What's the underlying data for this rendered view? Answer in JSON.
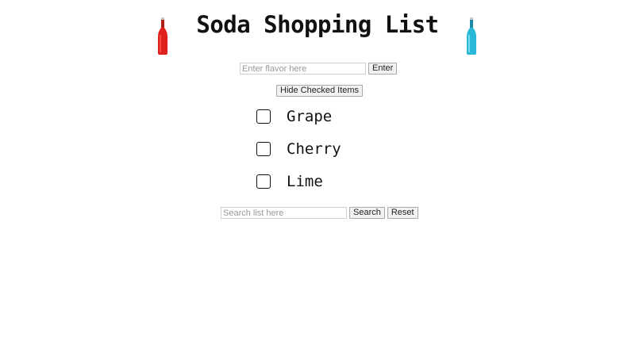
{
  "header": {
    "title": "Soda Shopping List",
    "left_icon": "red-soda-bottle-icon",
    "right_icon": "blue-soda-bottle-icon"
  },
  "flavor_form": {
    "placeholder": "Enter flavor here",
    "value": "",
    "enter_label": "Enter"
  },
  "hide_checked_label": "Hide Checked Items",
  "items": [
    {
      "label": "Grape",
      "checked": false
    },
    {
      "label": "Cherry",
      "checked": false
    },
    {
      "label": "Lime",
      "checked": false
    }
  ],
  "search_form": {
    "placeholder": "Search list here",
    "value": "",
    "search_label": "Search",
    "reset_label": "Reset"
  },
  "colors": {
    "red_bottle": "#e0201b",
    "blue_bottle": "#2ab8d8",
    "text": "#111111"
  }
}
